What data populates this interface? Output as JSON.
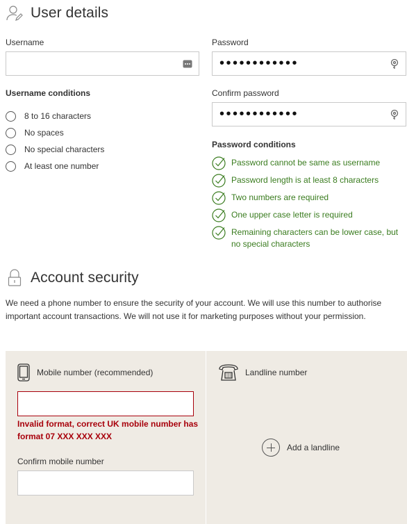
{
  "user_details": {
    "title": "User details",
    "icon": "user-edit-icon",
    "username_label": "Username",
    "username_value": "",
    "password_label": "Password",
    "password_mask": "••••••••••••",
    "confirm_password_label": "Confirm password",
    "confirm_password_mask": "••••••••••••",
    "username_conditions_title": "Username conditions",
    "username_conditions": [
      "8 to 16 characters",
      "No spaces",
      "No special characters",
      "At least one number"
    ],
    "password_conditions_title": "Password conditions",
    "password_conditions": [
      "Password cannot be same as username",
      "Password length is at least 8 characters",
      "Two numbers are required",
      "One upper case letter is required",
      "Remaining characters can be lower case, but no special characters"
    ]
  },
  "account_security": {
    "title": "Account security",
    "icon": "padlock-icon",
    "intro": "We need a phone number to ensure the security of your account. We will use this number to authorise important account transactions. We will not use it for marketing purposes without your permission.",
    "mobile": {
      "label": "Mobile number (recommended)",
      "icon": "mobile-phone-icon",
      "value": "",
      "error": "Invalid format, correct UK mobile number has format 07 XXX XXX XXX",
      "confirm_label": "Confirm mobile number",
      "confirm_value": ""
    },
    "landline": {
      "label": "Landline number",
      "icon": "landline-phone-icon",
      "add_label": "Add a landline"
    }
  },
  "colors": {
    "success_green": "#3a7c1f",
    "error_red": "#a8000b",
    "panel_bg": "#efebe4"
  }
}
